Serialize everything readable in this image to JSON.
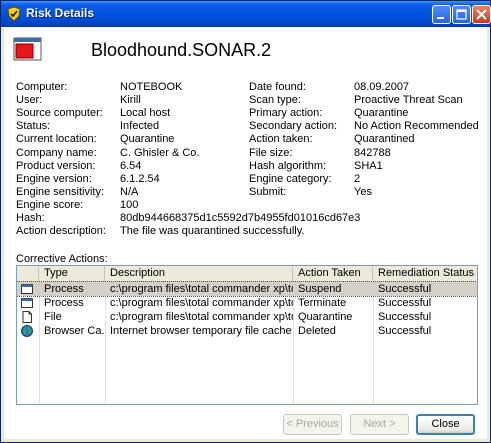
{
  "window": {
    "title": "Risk Details"
  },
  "threat": {
    "name": "Bloodhound.SONAR.2"
  },
  "details_left": [
    {
      "label": "Computer:",
      "value": "NOTEBOOK"
    },
    {
      "label": "User:",
      "value": "Kirill"
    },
    {
      "label": "Source computer:",
      "value": "Local host"
    },
    {
      "label": "Status:",
      "value": "Infected"
    },
    {
      "label": "Current location:",
      "value": "Quarantine"
    },
    {
      "label": "Company name:",
      "value": "C. Ghisler & Co."
    },
    {
      "label": "Product version:",
      "value": "6.54"
    },
    {
      "label": "Engine version:",
      "value": "6.1.2.54"
    },
    {
      "label": "Engine sensitivity:",
      "value": "N/A"
    },
    {
      "label": "Engine score:",
      "value": "100"
    },
    {
      "label": "Hash:",
      "value": "80db944668375d1c5592d7b4955fd01016cd67e3"
    },
    {
      "label": "Action description:",
      "value": "The file was quarantined successfully."
    }
  ],
  "details_right": [
    {
      "label": "Date found:",
      "value": "08.09.2007"
    },
    {
      "label": "Scan type:",
      "value": "Proactive Threat Scan"
    },
    {
      "label": "Primary action:",
      "value": "Quarantine"
    },
    {
      "label": "Secondary action:",
      "value": "No Action Recommended"
    },
    {
      "label": "Action taken:",
      "value": "Quarantined"
    },
    {
      "label": "File size:",
      "value": "842788"
    },
    {
      "label": "Hash algorithm:",
      "value": "SHA1"
    },
    {
      "label": "Engine category:",
      "value": "2"
    },
    {
      "label": "Submit:",
      "value": "Yes"
    }
  ],
  "corrective": {
    "label": "Corrective Actions:",
    "columns": [
      "Type",
      "Description",
      "Action Taken",
      "Remediation Status"
    ],
    "rows": [
      {
        "icon": "process-icon",
        "type": "Process",
        "description": "c:\\program files\\total commander xp\\totalc...",
        "action": "Suspend",
        "status": "Successful"
      },
      {
        "icon": "process-icon",
        "type": "Process",
        "description": "c:\\program files\\total commander xp\\totalc...",
        "action": "Terminate",
        "status": "Successful"
      },
      {
        "icon": "file-icon",
        "type": "File",
        "description": "c:\\program files\\total commander xp\\totalc...",
        "action": "Quarantine",
        "status": "Successful"
      },
      {
        "icon": "globe-icon",
        "type": "Browser Ca...",
        "description": "Internet browser temporary file cache",
        "action": "Deleted",
        "status": "Successful"
      }
    ]
  },
  "buttons": {
    "previous": "< Previous",
    "next": "Next >",
    "close": "Close"
  }
}
